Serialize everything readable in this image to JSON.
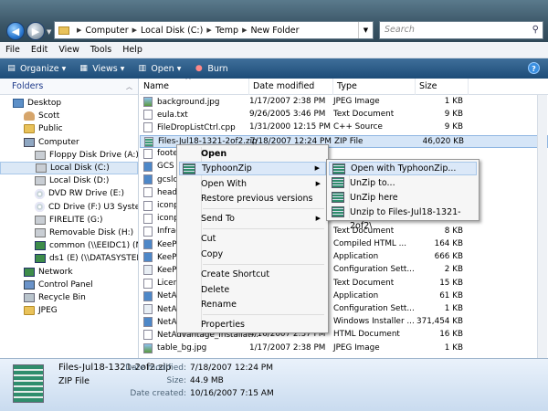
{
  "address": {
    "crumbs": [
      "Computer",
      "Local Disk (C:)",
      "Temp",
      "New Folder"
    ],
    "search_placeholder": "Search"
  },
  "menu": [
    "File",
    "Edit",
    "View",
    "Tools",
    "Help"
  ],
  "toolbar": {
    "organize": "Organize",
    "views": "Views",
    "open": "Open",
    "burn": "Burn"
  },
  "sidebar": {
    "heading": "Folders",
    "items": [
      {
        "label": "Desktop",
        "icon": "desktop-icon"
      },
      {
        "label": "Scott",
        "icon": "user-folder-icon"
      },
      {
        "label": "Public",
        "icon": "folder-icon"
      },
      {
        "label": "Computer",
        "icon": "computer-icon"
      },
      {
        "label": "Floppy Disk Drive (A:)",
        "icon": "floppy-drive-icon"
      },
      {
        "label": "Local Disk (C:)",
        "icon": "hard-drive-icon"
      },
      {
        "label": "Local Disk (D:)",
        "icon": "hard-drive-icon"
      },
      {
        "label": "DVD RW Drive (E:)",
        "icon": "dvd-drive-icon"
      },
      {
        "label": "CD Drive (F:) U3 System",
        "icon": "cd-drive-icon"
      },
      {
        "label": "FIRELITE (G:)",
        "icon": "removable-drive-icon"
      },
      {
        "label": "Removable Disk (H:)",
        "icon": "removable-drive-icon"
      },
      {
        "label": "common (\\\\EEIDC1) (N:)",
        "icon": "network-drive-icon"
      },
      {
        "label": "ds1 (E) (\\\\DATASYSTEMS",
        "icon": "network-drive-icon"
      },
      {
        "label": "Network",
        "icon": "network-icon"
      },
      {
        "label": "Control Panel",
        "icon": "control-panel-icon"
      },
      {
        "label": "Recycle Bin",
        "icon": "recycle-bin-icon"
      },
      {
        "label": "JPEG",
        "icon": "folder-icon"
      }
    ]
  },
  "columns": {
    "name": "Name",
    "date": "Date modified",
    "type": "Type",
    "size": "Size"
  },
  "files": [
    {
      "name": "background.jpg",
      "date": "1/17/2007 2:38 PM",
      "type": "JPEG Image",
      "size": "1 KB",
      "kind": "jpg"
    },
    {
      "name": "eula.txt",
      "date": "9/26/2005 3:46 PM",
      "type": "Text Document",
      "size": "9 KB",
      "kind": "doc"
    },
    {
      "name": "FileDropListCtrl.cpp",
      "date": "1/31/2000 12:15 PM",
      "type": "C++ Source",
      "size": "9 KB",
      "kind": "doc"
    },
    {
      "name": "Files-Jul18-1321-2of2.zip",
      "date": "7/18/2007 12:24 PM",
      "type": "ZIP File",
      "size": "46,020 KB",
      "kind": "zip"
    },
    {
      "name": "foote",
      "date": "",
      "type": "",
      "size": "",
      "kind": "doc"
    },
    {
      "name": "GCS I",
      "date": "",
      "type": "",
      "size": "",
      "kind": "app"
    },
    {
      "name": "gcslo",
      "date": "",
      "type": "",
      "size": "",
      "kind": "app"
    },
    {
      "name": "heade",
      "date": "",
      "type": "",
      "size": "",
      "kind": "doc"
    },
    {
      "name": "iconp",
      "date": "",
      "type": "",
      "size": "",
      "kind": "doc"
    },
    {
      "name": "iconp",
      "date": "",
      "type": "",
      "size": "",
      "kind": "doc"
    },
    {
      "name": "Infrag",
      "date": "",
      "type": "Text Document",
      "size": "8 KB",
      "kind": "doc"
    },
    {
      "name": "KeeP",
      "date": "",
      "type": "Compiled HTML ...",
      "size": "164 KB",
      "kind": "app"
    },
    {
      "name": "KeeP",
      "date": "",
      "type": "Application",
      "size": "666 KB",
      "kind": "app"
    },
    {
      "name": "KeeP",
      "date": "",
      "type": "Configuration Sett...",
      "size": "2 KB",
      "kind": "cfg"
    },
    {
      "name": "Licen",
      "date": "",
      "type": "Text Document",
      "size": "15 KB",
      "kind": "doc"
    },
    {
      "name": "NetA",
      "date": "",
      "type": "Application",
      "size": "61 KB",
      "kind": "app"
    },
    {
      "name": "NetA",
      "date": "",
      "type": "Configuration Sett...",
      "size": "1 KB",
      "kind": "cfg"
    },
    {
      "name": "NetA",
      "date": "",
      "type": "Windows Installer ...",
      "size": "371,454 KB",
      "kind": "app"
    },
    {
      "name": "NetAdvantage_Installat...",
      "date": "4/16/2007 2:37 PM",
      "type": "HTML Document",
      "size": "16 KB",
      "kind": "doc"
    },
    {
      "name": "table_bg.jpg",
      "date": "1/17/2007 2:38 PM",
      "type": "JPEG Image",
      "size": "1 KB",
      "kind": "jpg"
    }
  ],
  "context_menu": {
    "open": "Open",
    "typhoonzip": "TyphoonZip",
    "open_with": "Open With",
    "restore": "Restore previous versions",
    "send_to": "Send To",
    "cut": "Cut",
    "copy": "Copy",
    "create_shortcut": "Create Shortcut",
    "delete": "Delete",
    "rename": "Rename",
    "properties": "Properties"
  },
  "submenu": {
    "open_with_typhoonzip": "Open with TyphoonZip...",
    "unzip_to": "UnZip to...",
    "unzip_here": "UnZip here",
    "unzip_to_folder": "Unzip to Files-Jul18-1321-2of2\\"
  },
  "details": {
    "name": "Files-Jul18-1321-2of2.zip",
    "type": "ZIP File",
    "modified_label": "Date modified:",
    "modified": "7/18/2007 12:24 PM",
    "size_label": "Size:",
    "size": "44.9 MB",
    "created_label": "Date created:",
    "created": "10/16/2007 7:15 AM"
  }
}
